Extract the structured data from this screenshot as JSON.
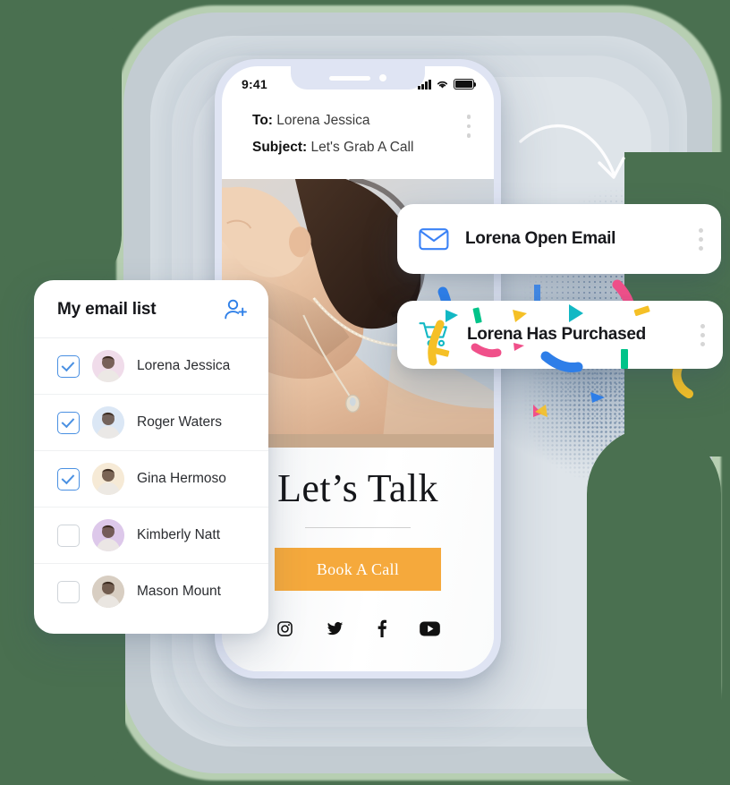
{
  "phone": {
    "status": {
      "time": "9:41",
      "signal_icon": "signal-bars-icon",
      "wifi_icon": "wifi-icon",
      "battery_icon": "battery-icon"
    },
    "mail": {
      "to_label": "To:",
      "to_value": "Lorena Jessica",
      "subject_label": "Subject:",
      "subject_value": "Let's Grab A Call",
      "menu_icon": "more-vertical-icon"
    },
    "hero": {
      "alt": "woman wearing necklace"
    },
    "cta_section": {
      "title": "Let’s Talk",
      "button_label": "Book A Call",
      "button_color": "#f5a93c"
    },
    "socials": [
      {
        "name": "instagram-icon",
        "label": "Instagram"
      },
      {
        "name": "twitter-icon",
        "label": "Twitter"
      },
      {
        "name": "facebook-icon",
        "label": "Facebook"
      },
      {
        "name": "youtube-icon",
        "label": "YouTube"
      }
    ]
  },
  "email_list": {
    "title": "My email list",
    "add_icon": "add-user-icon",
    "accent_color": "#4a90e2",
    "people": [
      {
        "name": "Lorena Jessica",
        "checked": true,
        "avatar_tint": "#f0dcea"
      },
      {
        "name": "Roger Waters",
        "checked": true,
        "avatar_tint": "#dbe7f5"
      },
      {
        "name": "Gina Hermoso",
        "checked": true,
        "avatar_tint": "#f6ead6"
      },
      {
        "name": "Kimberly Natt",
        "checked": false,
        "avatar_tint": "#ddc8ea"
      },
      {
        "name": "Mason Mount",
        "checked": false,
        "avatar_tint": "#d8cec2"
      }
    ]
  },
  "notifications": [
    {
      "id": "open-email",
      "label": "Lorena Open Email",
      "icon": "envelope-icon",
      "icon_color": "#3b82f6",
      "menu_icon": "more-vertical-icon"
    },
    {
      "id": "purchased",
      "label": "Lorena Has Purchased",
      "icon": "shopping-cart-icon",
      "icon_color": "#12b8c4",
      "menu_icon": "more-vertical-icon"
    }
  ],
  "decor": {
    "arrow_icon": "curved-arrow-icon",
    "background_color": "#4a7050",
    "confetti_colors": [
      "#2e7ee8",
      "#00c389",
      "#f5c026",
      "#f0508a",
      "#12b8c4"
    ]
  }
}
